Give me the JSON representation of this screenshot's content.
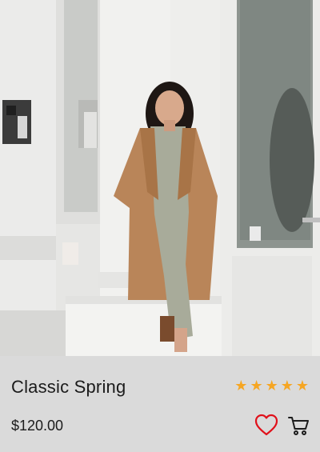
{
  "product": {
    "title": "Classic Spring",
    "price": "$120.00",
    "rating": 5,
    "rating_max": 5
  },
  "icons": {
    "wishlist": "heart-icon",
    "cart": "cart-icon",
    "star": "star-icon"
  },
  "colors": {
    "star": "#f6a623",
    "heart": "#e0101a",
    "text": "#1b1b1b",
    "info_bg": "#dadada"
  }
}
